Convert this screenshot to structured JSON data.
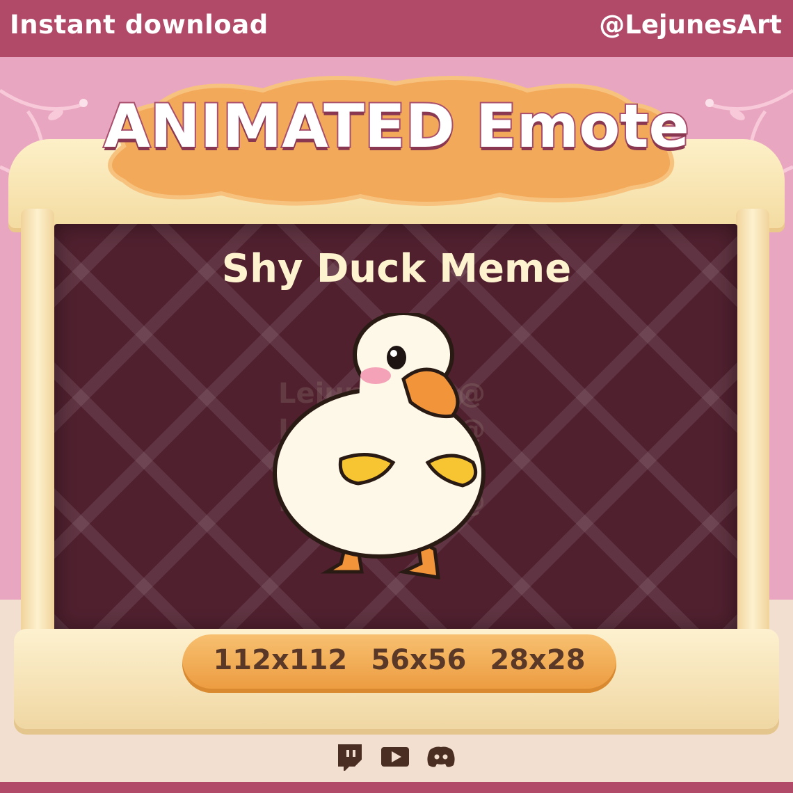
{
  "header": {
    "left_text": "Instant download",
    "right_text": "@LejunesArt"
  },
  "title": "ANIMATED Emote",
  "subtitle": "Shy Duck Meme",
  "sizes": [
    "112x112",
    "56x56",
    "28x28"
  ],
  "watermark": "LejunesArt @Lej",
  "social_icons": [
    "twitch-icon",
    "youtube-icon",
    "discord-icon"
  ],
  "colors": {
    "header": "#b04a68",
    "background_pink": "#e9a6c0",
    "board": "#50202f",
    "cloud_orange": "#f2a95a",
    "title_text": "#ffffff",
    "subtitle_text": "#fdf3cf",
    "size_text": "#5a3828"
  }
}
